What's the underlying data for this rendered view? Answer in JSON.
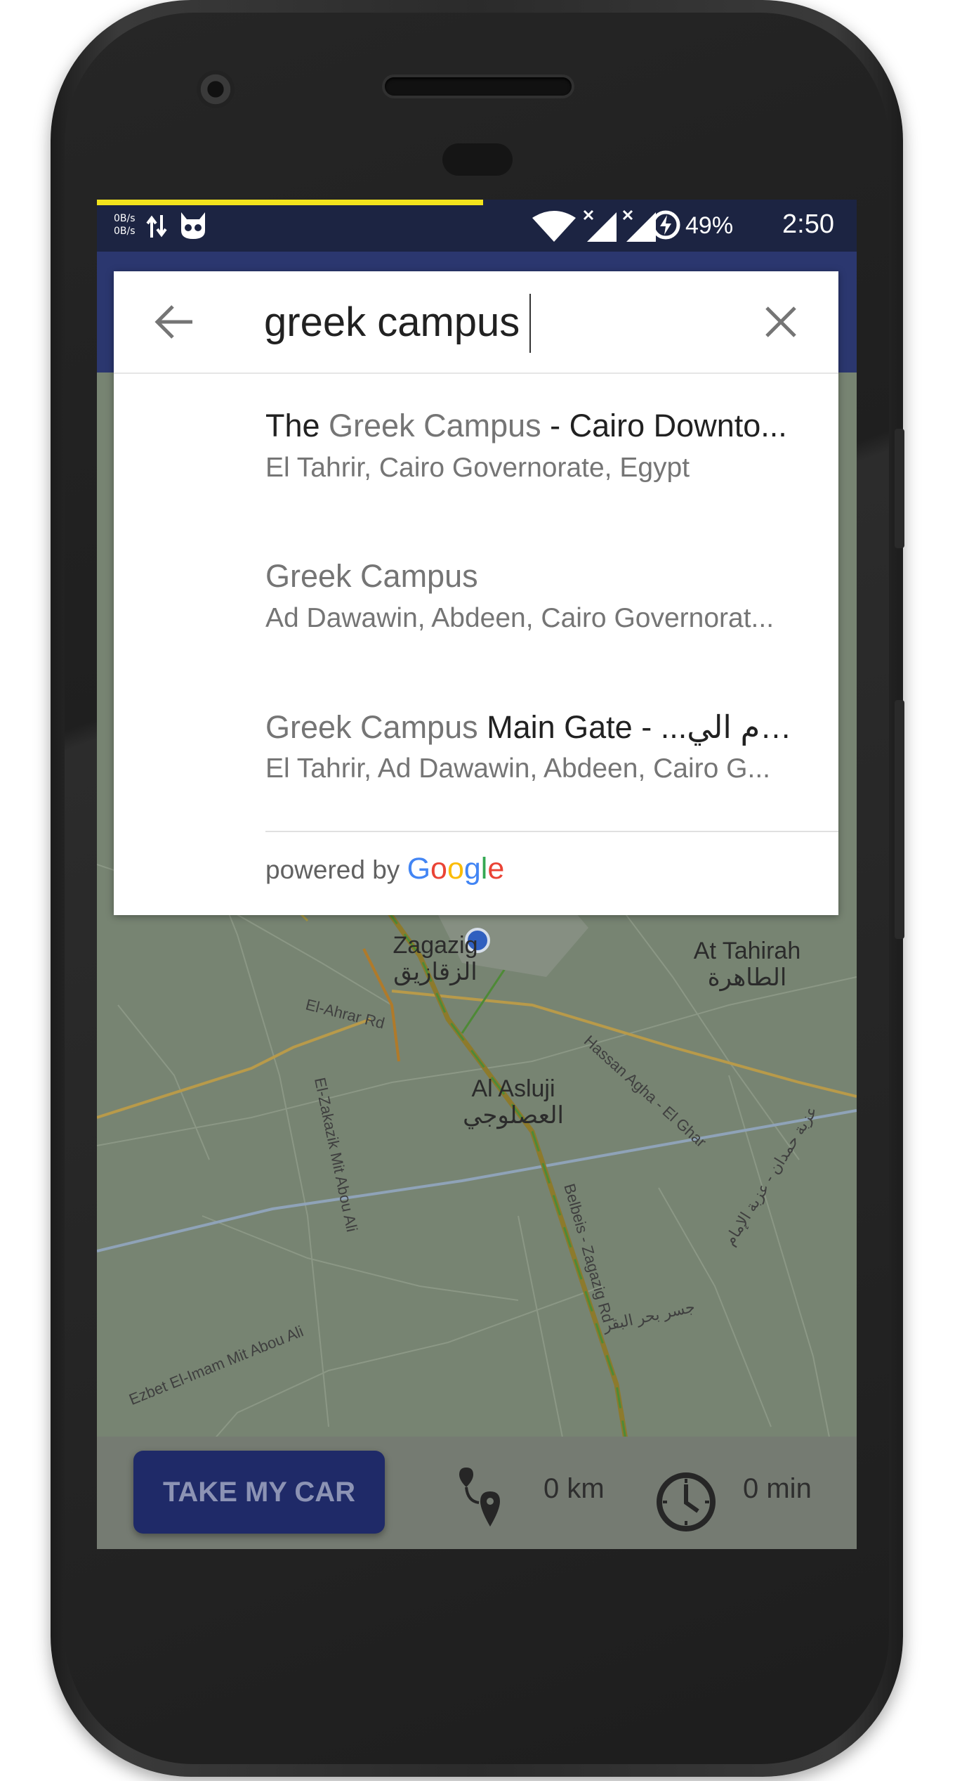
{
  "status_bar": {
    "net_up": "0B/s",
    "net_down": "0B/s",
    "battery_percent": "49%",
    "time": "2:50",
    "icons": [
      "data-transfer-icon",
      "app-notification-icon",
      "wifi-icon",
      "signal-icon",
      "signal-icon",
      "battery-charging-icon"
    ]
  },
  "search": {
    "query": "greek campus",
    "back_icon": "arrow-back-icon",
    "clear_icon": "close-icon"
  },
  "suggestions": [
    {
      "title_prefix": "The ",
      "title_match": "Greek Campus",
      "title_rest": " - Cairo Downto...",
      "subtitle": "El Tahrir, Cairo Governorate, Egypt"
    },
    {
      "title_prefix": "",
      "title_match": "Greek Campus",
      "title_rest": "",
      "subtitle": "Ad Dawawin, Abdeen, Cairo Governorat..."
    },
    {
      "title_prefix": "",
      "title_match": "Greek Campus",
      "title_rest": " Main Gate - ...الحرم الي",
      "subtitle": "El Tahrir, Ad Dawawin, Abdeen, Cairo G..."
    }
  ],
  "attribution": {
    "powered_by": "powered by",
    "google": [
      "G",
      "o",
      "o",
      "g",
      "l",
      "e"
    ],
    "google_colors": [
      "#4285F4",
      "#EA4335",
      "#FBBC05",
      "#4285F4",
      "#34A853",
      "#EA4335"
    ]
  },
  "map": {
    "labels": {
      "zagazig": "Zagazig",
      "zagazig_ar": "الزقازيق",
      "at_tahirah": "At Tahirah",
      "at_tahirah_ar": "الطاهرة",
      "al_asluji": "Al Asluji",
      "al_asluji_ar": "العصلوجي",
      "el_ahrar": "El-Ahrar Rd",
      "hassan_agha": "Hassan Agha - El Ghar",
      "el_zakazik": "El-Zakazik Mit Abou Ali",
      "belbeis": "Belbeis - Zagazig Rd",
      "ezbet": "Ezbet El-Imam Mit Abou Ali",
      "jisr": "جسر بحر البقر",
      "izbat": "عزبة حمدان - عزبة الإمام"
    }
  },
  "bottom_bar": {
    "take_car_label": "TAKE MY CAR",
    "distance": "0 km",
    "duration": "0 min",
    "route_icon": "route-icon",
    "clock_icon": "clock-icon"
  },
  "colors": {
    "toolbar": "#2b376f",
    "status_bar": "#1c2442",
    "progress": "#f2e31c",
    "button": "#1f2a68",
    "map_overlay": "#778472"
  }
}
